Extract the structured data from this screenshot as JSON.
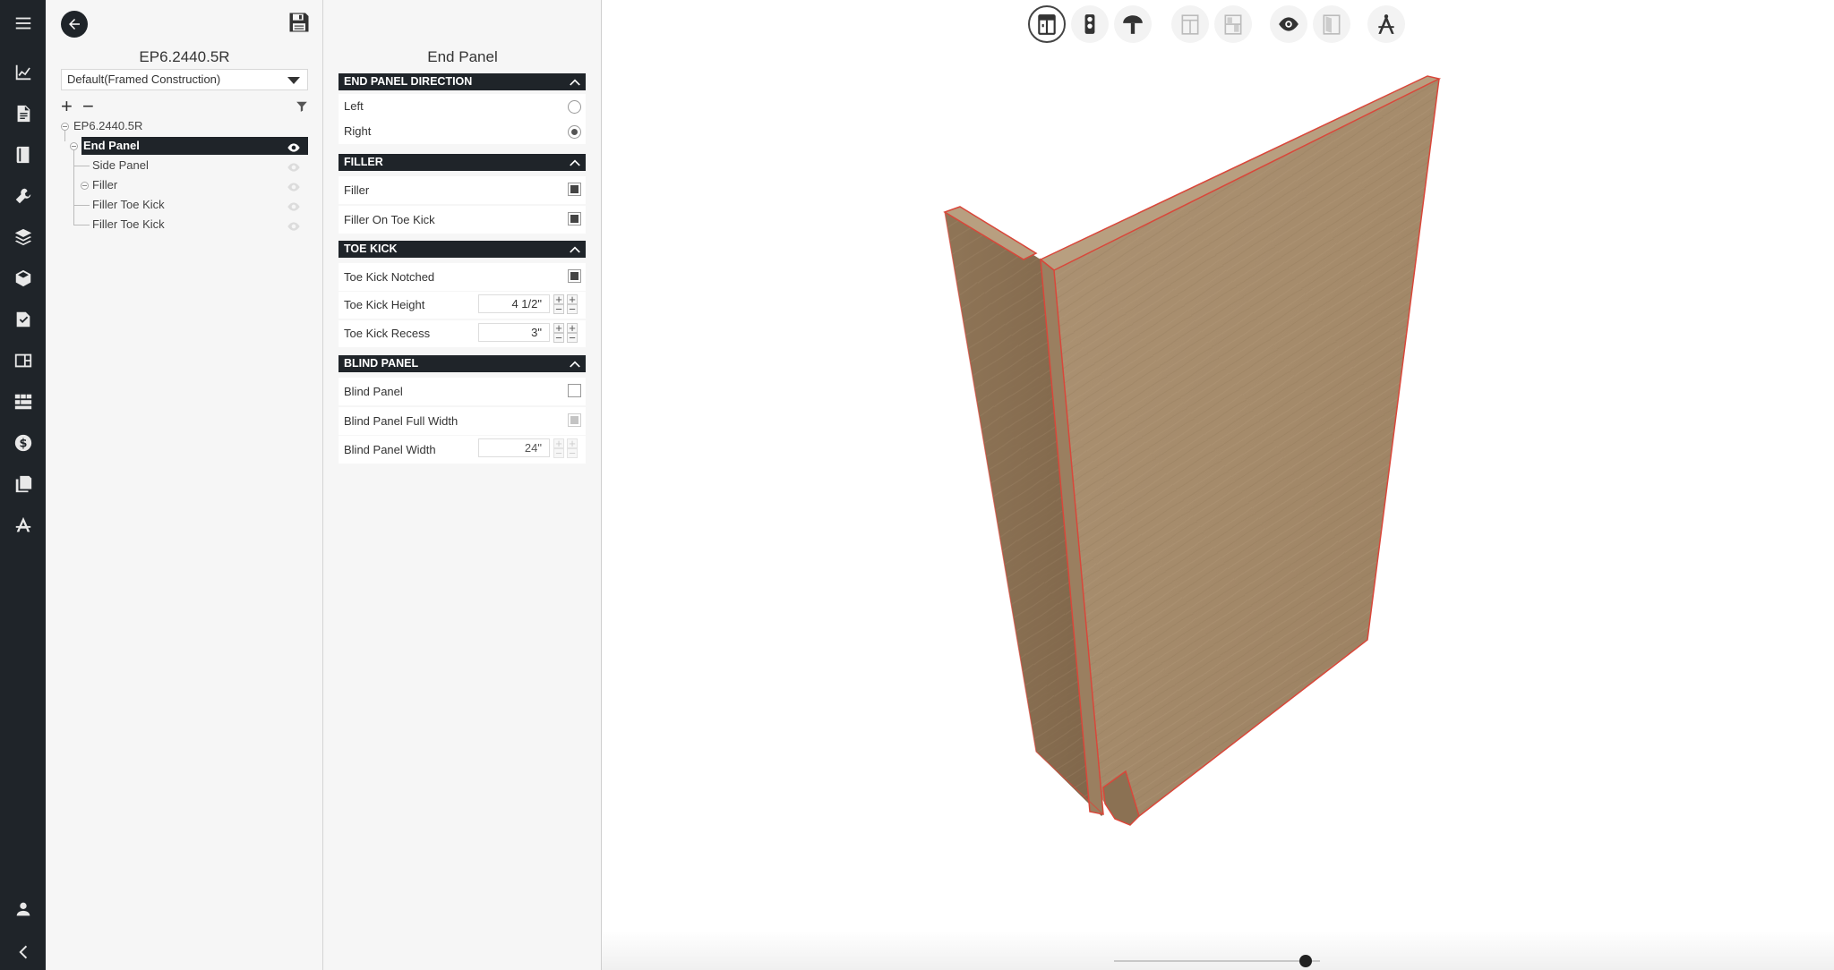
{
  "tree": {
    "title": "EP6.2440.5R",
    "preset": "Default(Framed Construction)",
    "root": "EP6.2440.5R",
    "nodes": [
      {
        "label": "End Panel"
      },
      {
        "label": "Side Panel"
      },
      {
        "label": "Filler"
      },
      {
        "label": "Filler Toe Kick"
      },
      {
        "label": "Filler Toe Kick"
      }
    ]
  },
  "props": {
    "title": "End Panel",
    "sections": {
      "direction": {
        "title": "END PANEL DIRECTION",
        "left_label": "Left",
        "right_label": "Right",
        "selected": "Right"
      },
      "filler": {
        "title": "FILLER",
        "filler_label": "Filler",
        "filler_checked": true,
        "toe_label": "Filler On Toe Kick",
        "toe_checked": true
      },
      "toe_kick": {
        "title": "TOE KICK",
        "notched_label": "Toe Kick Notched",
        "notched_checked": true,
        "height_label": "Toe Kick Height",
        "height_value": "4 1/2\"",
        "recess_label": "Toe Kick Recess",
        "recess_value": "3\""
      },
      "blind_panel": {
        "title": "BLIND PANEL",
        "blind_label": "Blind Panel",
        "blind_checked": false,
        "full_label": "Blind Panel Full Width",
        "full_checked": true,
        "width_label": "Blind Panel Width",
        "width_value": "24\""
      }
    }
  },
  "stepper": {
    "plus": "+",
    "minus": "−"
  },
  "colors": {
    "rail": "#1f2429",
    "panel": "#f6f6f6",
    "wood": "#a4896a",
    "edge": "#d9473a"
  },
  "icons": {
    "rail": [
      "menu-icon",
      "chart-icon",
      "document-icon",
      "book-icon",
      "tools-icon",
      "layers-icon",
      "cube-icon",
      "catalog-icon",
      "layout-icon",
      "grid-icon",
      "dollar-icon",
      "copy-icon",
      "drafting-icon",
      "user-icon",
      "collapse-icon"
    ],
    "toolbar": [
      "cabinet-view-icon",
      "traffic-light-icon",
      "mushroom-icon",
      "wireframe-icon",
      "section-icon",
      "eye-icon",
      "door-icon",
      "compass-icon"
    ]
  },
  "zoom_level": 0.93
}
